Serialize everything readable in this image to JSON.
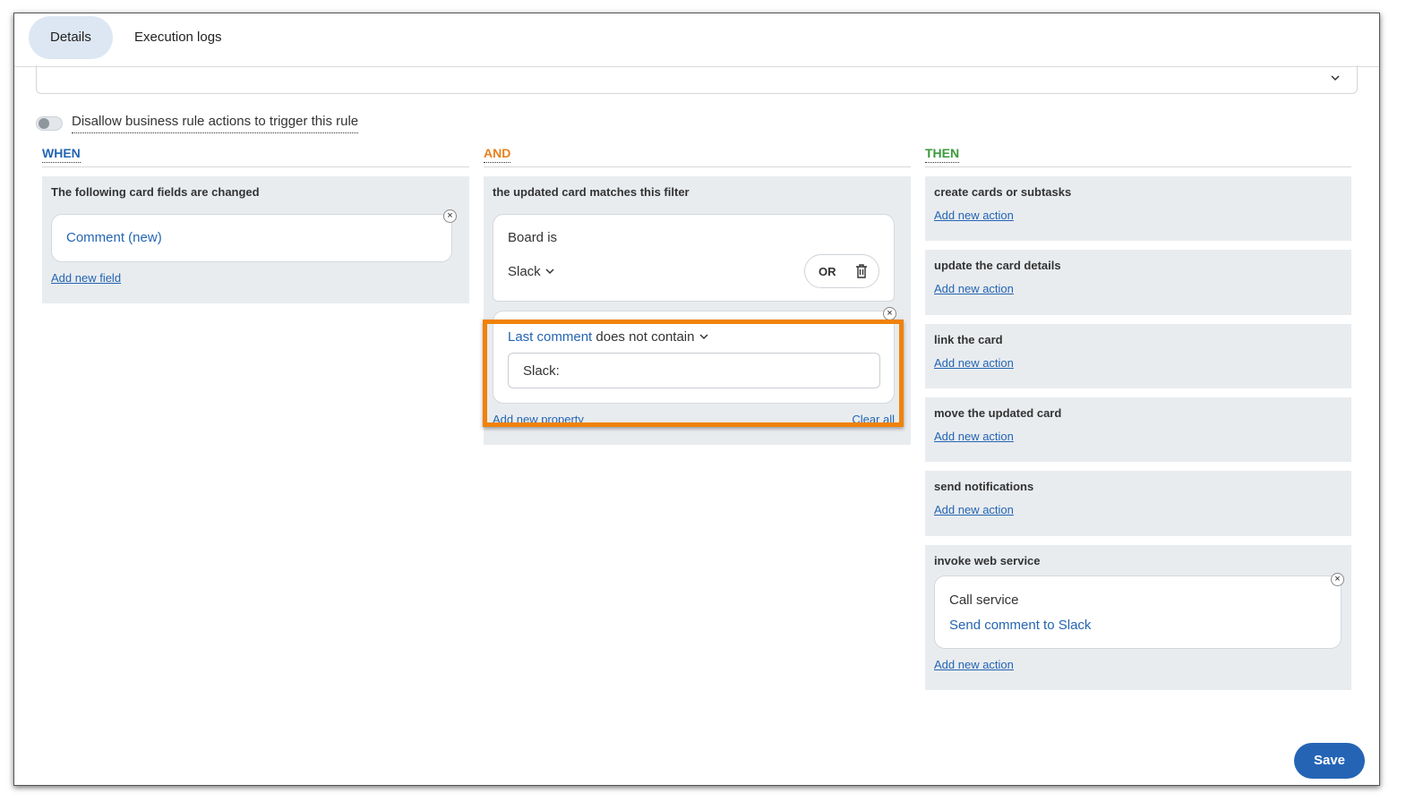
{
  "tabs": [
    {
      "label": "Details",
      "active": true
    },
    {
      "label": "Execution logs",
      "active": false
    }
  ],
  "toggle": {
    "label": "Disallow business rule actions to trigger this rule",
    "on": false
  },
  "when": {
    "header": "WHEN",
    "panel_title": "The following card fields are changed",
    "field": "Comment (new)",
    "add_link": "Add new field"
  },
  "and": {
    "header": "AND",
    "panel_title": "the updated card matches this filter",
    "board_label": "Board is",
    "board_value": "Slack",
    "or_button": "OR",
    "property_name": "Last comment",
    "property_operator": "does not contain",
    "property_value": "Slack:",
    "add_property": "Add new property",
    "clear_all": "Clear all"
  },
  "then": {
    "header": "THEN",
    "sections": [
      {
        "title": "create cards or subtasks",
        "link": "Add new action"
      },
      {
        "title": "update the card details",
        "link": "Add new action"
      },
      {
        "title": "link the card",
        "link": "Add new action"
      },
      {
        "title": "move the updated card",
        "link": "Add new action"
      },
      {
        "title": "send notifications",
        "link": "Add new action"
      }
    ],
    "web_service": {
      "title": "invoke web service",
      "card_label": "Call service",
      "card_value": "Send comment to Slack",
      "link": "Add new action"
    }
  },
  "colors": {
    "when": "#2465b3",
    "and": "#e8801e",
    "then": "#3a9a3a",
    "highlight": "#f0820a",
    "save": "#2564b5"
  },
  "save_label": "Save"
}
